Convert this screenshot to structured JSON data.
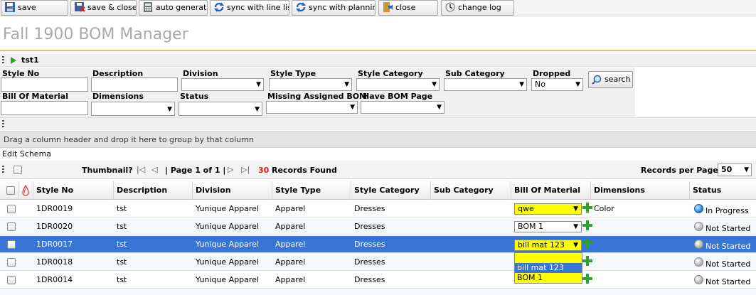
{
  "toolbar": {
    "buttons": [
      {
        "label": "save",
        "icon": "floppy-icon"
      },
      {
        "label": "save & close",
        "icon": "floppy-close-icon"
      },
      {
        "label": "auto generate",
        "icon": "calculator-icon"
      },
      {
        "label": "sync with line list",
        "icon": "sync-icon"
      },
      {
        "label": "sync with planning",
        "icon": "sync-icon"
      },
      {
        "label": "close",
        "icon": "close-door-icon"
      },
      {
        "label": "change log",
        "icon": "log-icon"
      }
    ]
  },
  "page": {
    "title": "Fall 1900 BOM Manager"
  },
  "search_panel": {
    "header": "tst1",
    "fields": {
      "style_no": "Style No",
      "description": "Description",
      "division": "Division",
      "style_type": "Style Type",
      "style_category": "Style Category",
      "sub_category": "Sub Category",
      "dropped": "Dropped",
      "dropped_value": "No",
      "bill_of_material": "Bill Of Material",
      "dimensions": "Dimensions",
      "status": "Status",
      "missing_assigned_bom": "Missing Assigned BOM",
      "have_bom_page": "Have BOM Page"
    },
    "search_label": "search"
  },
  "grid": {
    "group_hint": "Drag a column header and drop it here to group by that column",
    "edit_schema": "Edit Schema",
    "pager": {
      "thumbnail": "Thumbnail?",
      "page_text": "| Page 1 of 1 |",
      "records_count": "30",
      "records_found": "Records Found",
      "records_per_page_label": "Records per Page:",
      "records_per_page_value": "50"
    },
    "columns": [
      "Style No",
      "Description",
      "Division",
      "Style Type",
      "Style Category",
      "Sub Category",
      "Bill Of Material",
      "Dimensions",
      "Status"
    ],
    "rows": [
      {
        "style_no": "1DR0019",
        "description": "tst",
        "division": "Yunique Apparel",
        "style_type": "Apparel",
        "style_category": "Dresses",
        "bom": "qwe",
        "dimensions": "Color",
        "status": "In Progress"
      },
      {
        "style_no": "1DR0020",
        "description": "tst",
        "division": "Yunique Apparel",
        "style_type": "Apparel",
        "style_category": "Dresses",
        "bom": "BOM 1",
        "dimensions": "",
        "status": "Not Started"
      },
      {
        "style_no": "1DR0017",
        "description": "tst",
        "division": "Yunique Apparel",
        "style_type": "Apparel",
        "style_category": "Dresses",
        "bom": "bill mat 123",
        "dimensions": "",
        "status": "Not Started"
      },
      {
        "style_no": "1DR0018",
        "description": "tst",
        "division": "Yunique Apparel",
        "style_type": "Apparel",
        "style_category": "Dresses",
        "bom": "",
        "dimensions": "",
        "status": "Not Started"
      },
      {
        "style_no": "1DR0014",
        "description": "tst",
        "division": "Yunique Apparel",
        "style_type": "Apparel",
        "style_category": "Dresses",
        "bom": "",
        "dimensions": "",
        "status": "Not Started"
      }
    ],
    "bom_dropdown_options": [
      "",
      "bill mat 123",
      "BOM 1"
    ]
  }
}
